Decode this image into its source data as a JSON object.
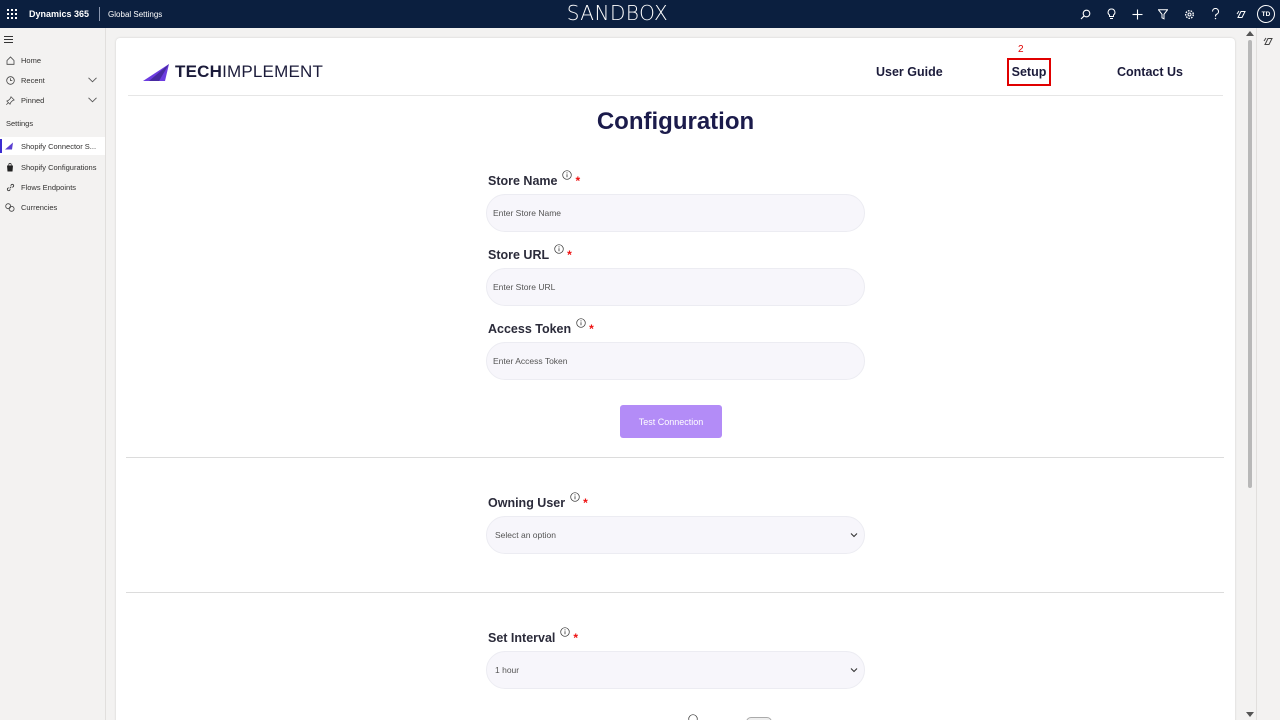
{
  "topbar": {
    "app_name": "Dynamics 365",
    "area_name": "Global Settings",
    "environment_banner": "SANDBOX",
    "avatar_initials": "TD"
  },
  "leftnav": {
    "items": [
      {
        "label": "Home",
        "icon": "home-icon"
      },
      {
        "label": "Recent",
        "icon": "clock-icon",
        "expandable": true
      },
      {
        "label": "Pinned",
        "icon": "pin-icon",
        "expandable": true
      }
    ],
    "section_header": "Settings",
    "settings_items": [
      {
        "label": "Shopify Connector S...",
        "icon": "techimplement-icon",
        "active": true
      },
      {
        "label": "Shopify Configurations",
        "icon": "shopify-bag-icon"
      },
      {
        "label": "Flows Endpoints",
        "icon": "link-icon"
      },
      {
        "label": "Currencies",
        "icon": "currency-icon"
      }
    ]
  },
  "header": {
    "logo_bold": "TECH",
    "logo_light": "IMPLEMENT",
    "links": {
      "user_guide": "User Guide",
      "setup": "Setup",
      "contact_us": "Contact Us"
    },
    "annotation_number": "2"
  },
  "form": {
    "title": "Configuration",
    "store_name": {
      "label": "Store Name",
      "placeholder": "Enter Store Name"
    },
    "store_url": {
      "label": "Store URL",
      "placeholder": "Enter Store URL"
    },
    "access_token": {
      "label": "Access Token",
      "placeholder": "Enter Access Token"
    },
    "test_connection_label": "Test Connection",
    "owning_user": {
      "label": "Owning User",
      "value": "Select an option"
    },
    "set_interval": {
      "label": "Set Interval",
      "value": "1 hour"
    },
    "required_mark": "*"
  },
  "colors": {
    "topbar": "#0b1f3f",
    "accent_purple": "#b38cf7",
    "title_navy": "#1b1b4b",
    "highlight_red": "#e00000"
  }
}
